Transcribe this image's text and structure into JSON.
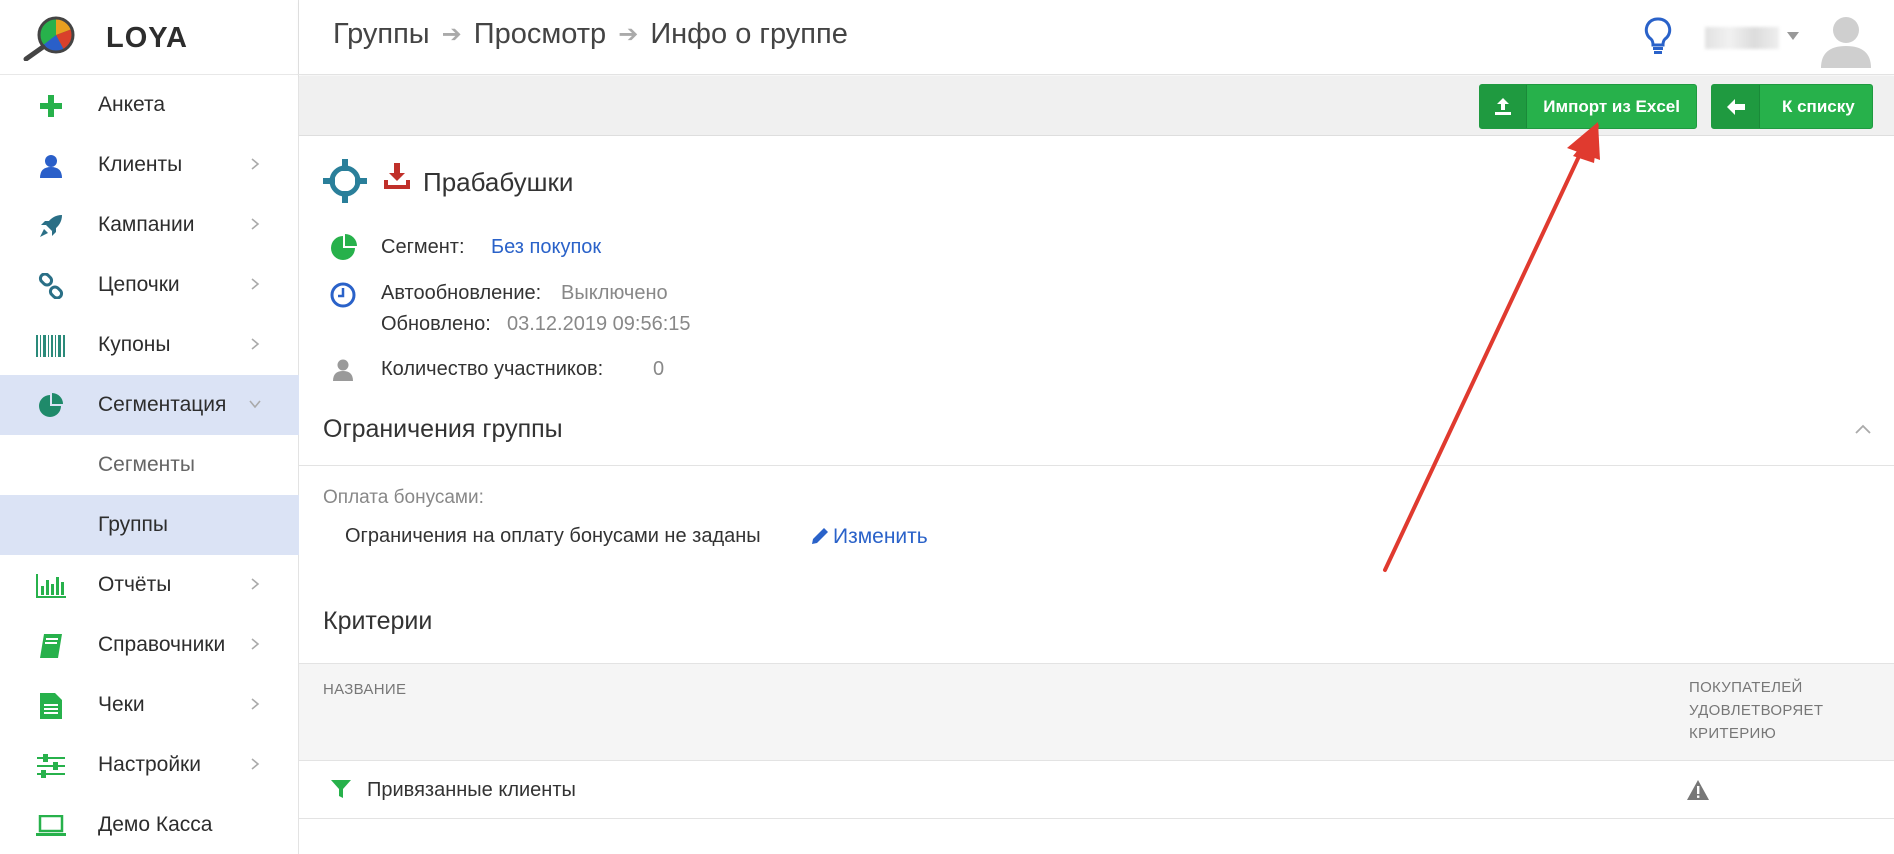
{
  "app": {
    "logo_text": "LOYA"
  },
  "header": {
    "breadcrumbs": [
      "Группы",
      "Просмотр",
      "Инфо о группе"
    ]
  },
  "sidebar": {
    "items": [
      {
        "label": "Анкета",
        "icon": "plus-icon",
        "color": "#27b14b",
        "has_chevron": false
      },
      {
        "label": "Клиенты",
        "icon": "user-icon",
        "color": "#2a5fc9",
        "has_chevron": true
      },
      {
        "label": "Кампании",
        "icon": "rocket-icon",
        "color": "#2a6f86",
        "has_chevron": true
      },
      {
        "label": "Цепочки",
        "icon": "link-icon",
        "color": "#2a6f86",
        "has_chevron": true
      },
      {
        "label": "Купоны",
        "icon": "barcode-icon",
        "color": "#2a8a7a",
        "has_chevron": true
      },
      {
        "label": "Сегментация",
        "icon": "pie-chart-icon",
        "color": "#1f8a6a",
        "has_chevron": true,
        "expanded": true
      },
      {
        "label": "Сегменты",
        "sub": true
      },
      {
        "label": "Группы",
        "sub": true,
        "active": true
      },
      {
        "label": "Отчёты",
        "icon": "bar-chart-icon",
        "color": "#27b14b",
        "has_chevron": true
      },
      {
        "label": "Справочники",
        "icon": "book-icon",
        "color": "#27b14b",
        "has_chevron": true
      },
      {
        "label": "Чеки",
        "icon": "receipt-icon",
        "color": "#27b14b",
        "has_chevron": true
      },
      {
        "label": "Настройки",
        "icon": "sliders-icon",
        "color": "#27b14b",
        "has_chevron": true
      },
      {
        "label": "Демо Касса",
        "icon": "laptop-icon",
        "color": "#27b14b",
        "has_chevron": false
      }
    ]
  },
  "toolbar": {
    "import_label": "Импорт из Excel",
    "back_label": "К списку",
    "accent": "#27b14b"
  },
  "group": {
    "name": "Прабабушки",
    "segment_label": "Сегмент:",
    "segment_value": "Без покупок",
    "autoupdate_label": "Автообновление:",
    "autoupdate_value": "Выключено",
    "updated_label": "Обновлено:",
    "updated_value": "03.12.2019 09:56:15",
    "members_label": "Количество участников:",
    "members_value": "0"
  },
  "restrictions": {
    "title": "Ограничения группы",
    "bonus_label": "Оплата бонусами:",
    "bonus_text": "Ограничения на оплату бонусами не заданы",
    "edit_label": "Изменить"
  },
  "criteria": {
    "title": "Критерии",
    "col_name": "НАЗВАНИЕ",
    "col_buyers": [
      "ПОКУПАТЕЛЕЙ",
      "УДОВЛЕТВОРЯЕТ",
      "КРИТЕРИЮ"
    ],
    "rows": [
      {
        "name": "Привязанные клиенты",
        "status_icon": "warning-icon"
      }
    ]
  },
  "annotation": {
    "arrow_color": "#e03a2f"
  }
}
